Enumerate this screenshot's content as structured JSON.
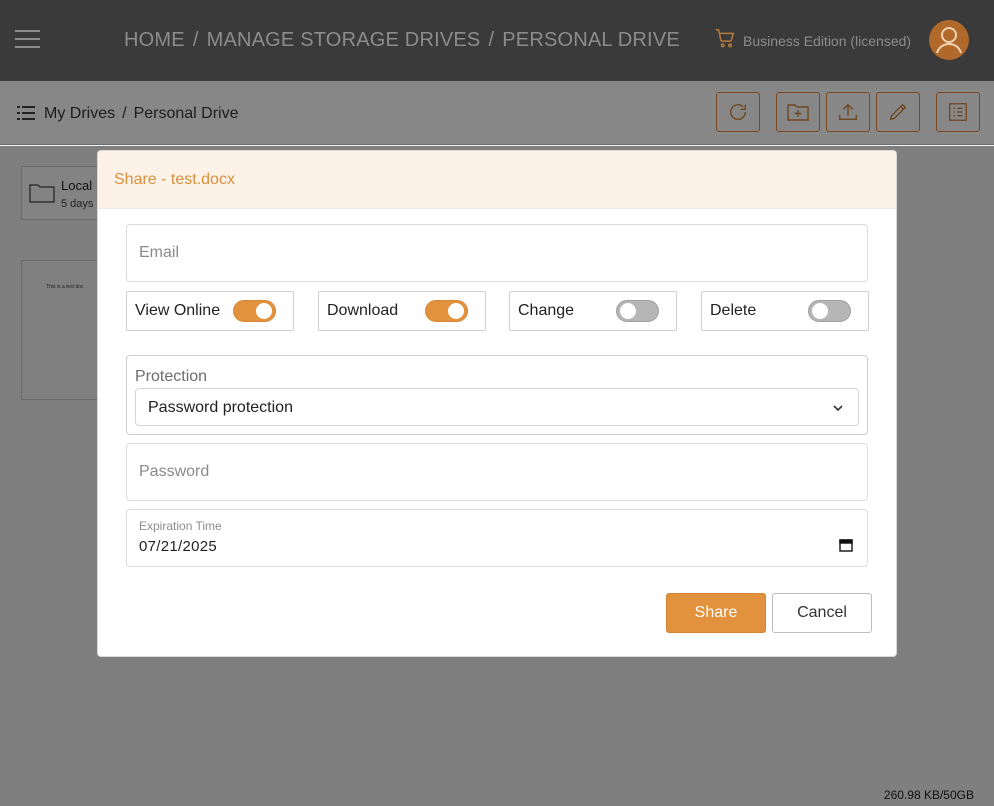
{
  "appbar": {
    "breadcrumb": [
      "HOME",
      "MANAGE STORAGE DRIVES",
      "PERSONAL DRIVE"
    ],
    "separator": "/",
    "edition": "Business Edition (licensed)",
    "icons": {
      "menu": "hamburger-icon",
      "cart": "cart-icon",
      "avatar": "user-avatar-icon"
    }
  },
  "toolbar": {
    "breadcrumb": [
      "My Drives",
      "Personal Drive"
    ],
    "separator": "/",
    "buttons": [
      "refresh-icon",
      "new-folder-icon",
      "upload-icon",
      "edit-icon",
      "details-list-icon"
    ]
  },
  "content": {
    "folder": {
      "name": "Local",
      "date": "5 days"
    },
    "file": {
      "preview_text": "This is a test doc"
    },
    "storage": "260.98 KB/50GB"
  },
  "modal": {
    "title": "Share - test.docx",
    "email_placeholder": "Email",
    "toggles": [
      {
        "label": "View Online",
        "on": true
      },
      {
        "label": "Download",
        "on": true
      },
      {
        "label": "Change",
        "on": false
      },
      {
        "label": "Delete",
        "on": false
      }
    ],
    "protection": {
      "label": "Protection",
      "value": "Password protection"
    },
    "password_placeholder": "Password",
    "expiration": {
      "label": "Expiration Time",
      "value": "07/21/2025"
    },
    "share_label": "Share",
    "cancel_label": "Cancel"
  },
  "colors": {
    "accent": "#e2923c",
    "header_tint": "#fdf2e7",
    "appbar": "#3a3a3a"
  }
}
